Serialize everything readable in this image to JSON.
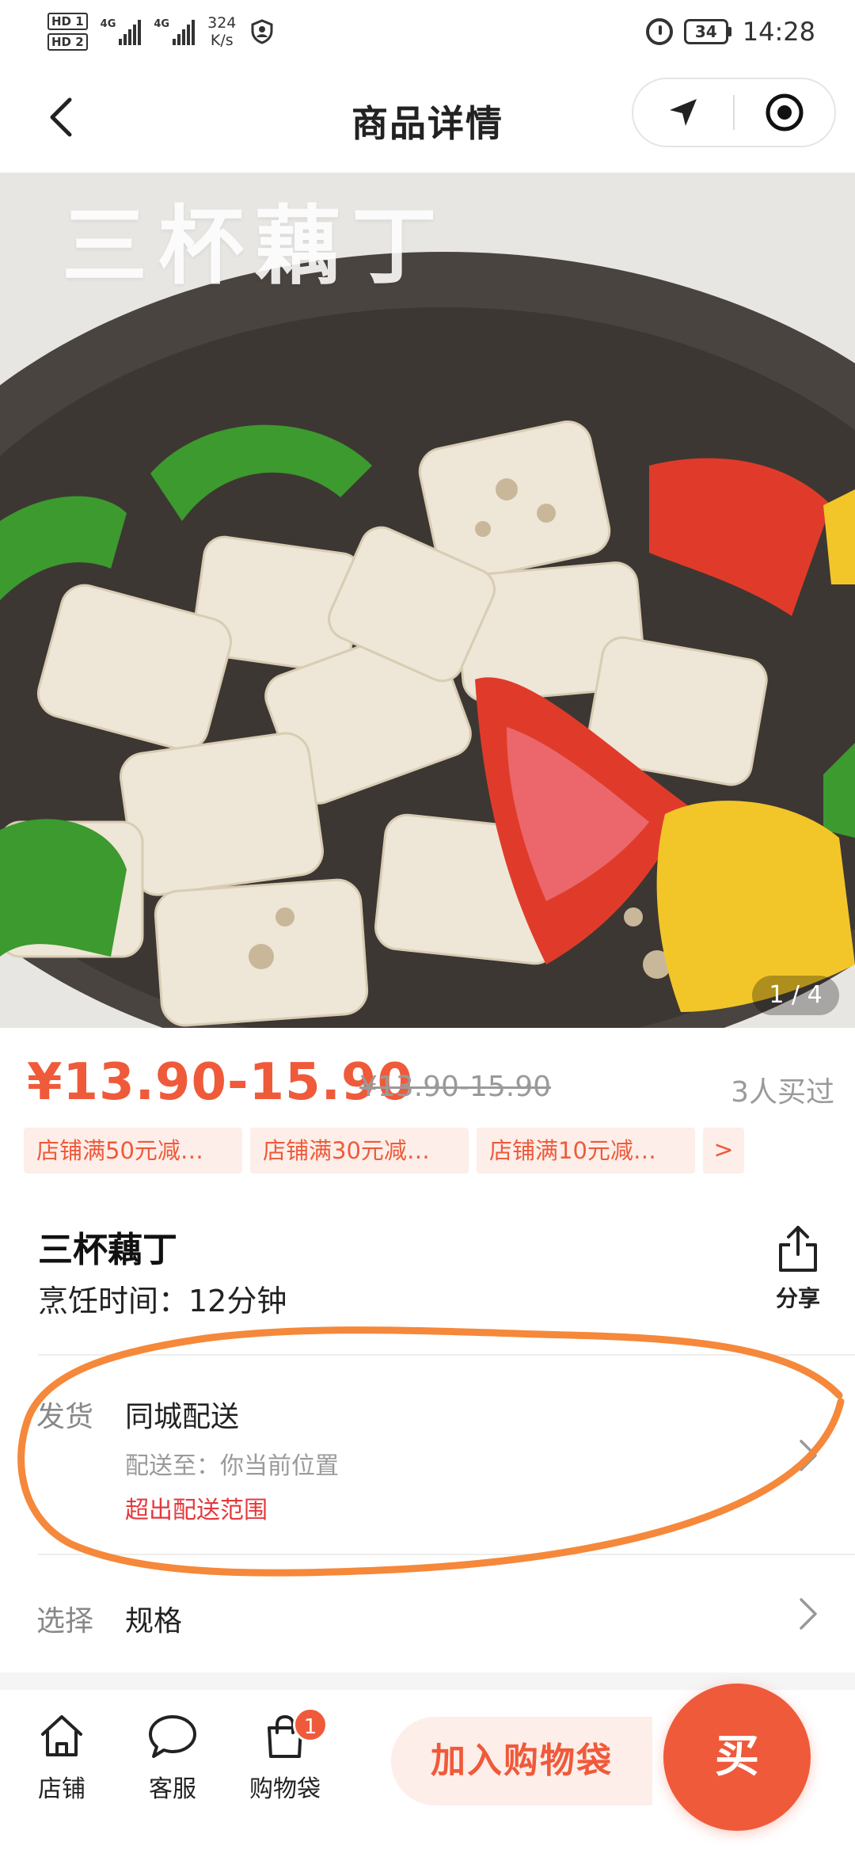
{
  "status_bar": {
    "hd1": "HD 1",
    "hd2": "HD 2",
    "net1": "4G",
    "net2": "4G",
    "speed_value": "324",
    "speed_unit": "K/s",
    "battery": "34",
    "time": "14:28"
  },
  "nav": {
    "title": "商品详情"
  },
  "gallery": {
    "overlay_text": "三杯藕丁",
    "counter": "1 / 4"
  },
  "price": {
    "current": "¥13.90-15.90",
    "original": "¥13.90-15.90",
    "sold": "3人买过"
  },
  "coupons": [
    "店铺满50元减…",
    "店铺满30元减…",
    "店铺满10元减…"
  ],
  "coupon_more": ">",
  "product": {
    "name": "三杯藕丁",
    "cook_time": "烹饪时间：12分钟",
    "share_label": "分享"
  },
  "shipping": {
    "key": "发货",
    "method": "同城配送",
    "destination": "配送至：你当前位置",
    "warning": "超出配送范围"
  },
  "spec": {
    "key": "选择",
    "value": "规格"
  },
  "bottom_bar": {
    "store": "店铺",
    "service": "客服",
    "bag": "购物袋",
    "bag_count": "1",
    "add_to_bag": "加入购物袋",
    "buy": "买"
  },
  "colors": {
    "accent": "#ef5a3a",
    "accent_light": "#fdeee9",
    "warning_text": "#e4393c",
    "annotation": "#f5883a"
  },
  "icons": {
    "back": "back-chevron-icon",
    "location": "location-arrow-icon",
    "record": "record-target-icon",
    "share": "share-upload-icon",
    "store": "store-house-icon",
    "service": "chat-bubble-icon",
    "bag": "shopping-bag-icon"
  }
}
